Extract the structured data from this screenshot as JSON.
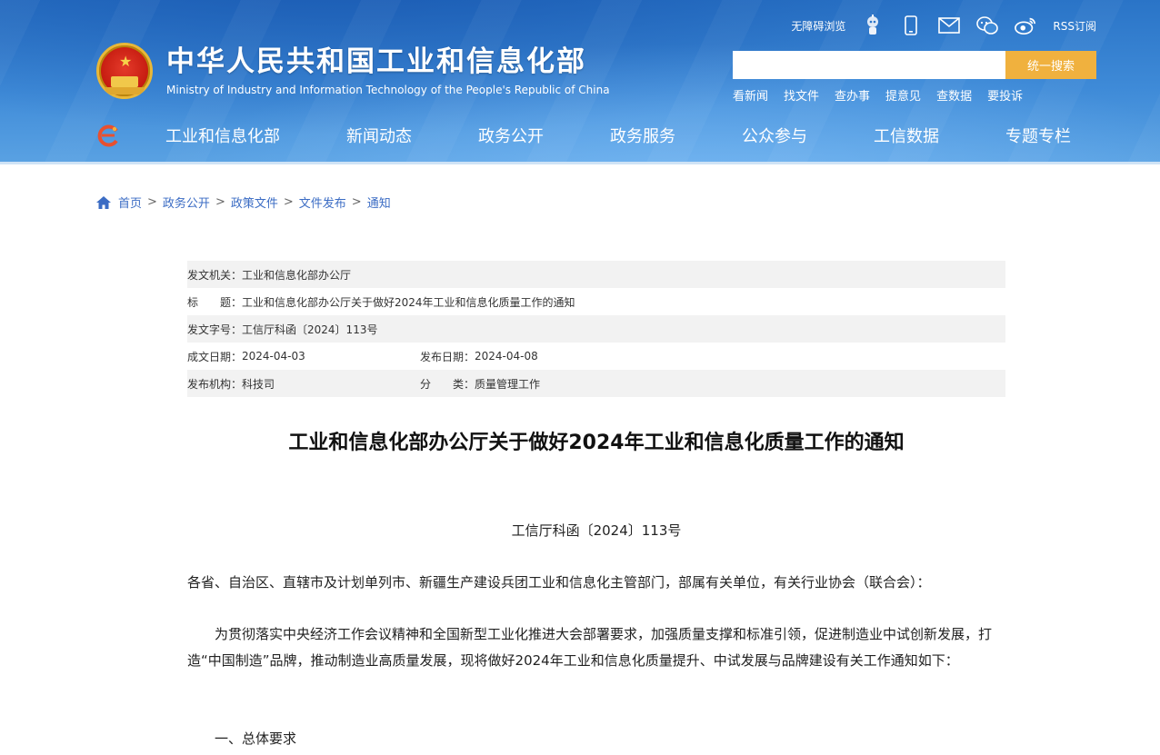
{
  "header": {
    "title": "中华人民共和国工业和信息化部",
    "subtitle": "Ministry of Industry and Information Technology of the People's Republic of China",
    "accessibility": "无障碍浏览",
    "rss": "RSS订阅",
    "search": {
      "placeholder": "",
      "button": "统一搜索"
    },
    "quick_links": [
      "看新闻",
      "找文件",
      "查办事",
      "提意见",
      "查数据",
      "要投诉"
    ],
    "nav": [
      "工业和信息化部",
      "新闻动态",
      "政务公开",
      "政务服务",
      "公众参与",
      "工信数据",
      "专题专栏"
    ]
  },
  "breadcrumb": [
    "首页",
    "政务公开",
    "政策文件",
    "文件发布",
    "通知"
  ],
  "meta": {
    "issuer_label": "发文机关：",
    "issuer": "工业和信息化部办公厅",
    "title_label": "标　　题：",
    "title": "工业和信息化部办公厅关于做好2024年工业和信息化质量工作的通知",
    "docno_label": "发文字号：",
    "docno": "工信厅科函〔2024〕113号",
    "created_label": "成文日期：",
    "created": "2024-04-03",
    "published_label": "发布日期：",
    "published": "2024-04-08",
    "org_label": "发布机构：",
    "org": "科技司",
    "category_label": "分　　类：",
    "category": "质量管理工作"
  },
  "document": {
    "title": "工业和信息化部办公厅关于做好2024年工业和信息化质量工作的通知",
    "number": "工信厅科函〔2024〕113号",
    "addressee": "各省、自治区、直辖市及计划单列市、新疆生产建设兵团工业和信息化主管部门，部属有关单位，有关行业协会（联合会）：",
    "body": "为贯彻落实中央经济工作会议精神和全国新型工业化推进大会部署要求，加强质量支撑和标准引领，促进制造业中试创新发展，打造“中国制造”品牌，推动制造业高质量发展，现将做好2024年工业和信息化质量提升、中试发展与品牌建设有关工作通知如下：",
    "section1": "一、总体要求"
  },
  "colors": {
    "header_blue": "#3f8bd8",
    "search_button": "#f0b13e",
    "link_blue": "#3b6cc4"
  }
}
